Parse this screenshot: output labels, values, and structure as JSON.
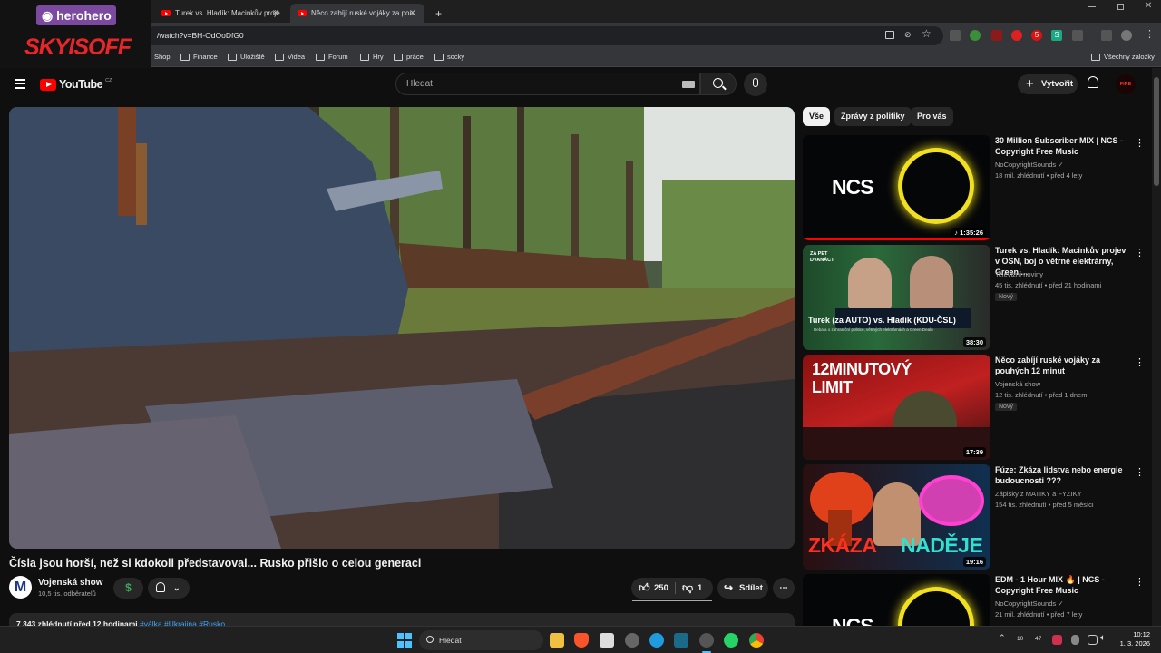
{
  "browser": {
    "tabs": [
      {
        "title": "Turek vs. Hladík: Macinkův proje",
        "close": "✕"
      },
      {
        "title": "Něco zabíjí ruské vojáky za pou",
        "close": "✕"
      }
    ],
    "new_tab": "+",
    "url": "/watch?v=BH-OdOoDfG0",
    "bookmarks": [
      "Shop",
      "Finance",
      "Uložiště",
      "Videa",
      "Forum",
      "Hry",
      "práce",
      "socky"
    ],
    "all_bookmarks": "Všechny záložky",
    "ext_badge": "5"
  },
  "overlay": {
    "brand_top": "herohero",
    "brand_main": "SKYISOFF"
  },
  "youtube": {
    "logo_text": "YouTube",
    "logo_country": "CZ",
    "search_placeholder": "Hledat",
    "create_label": "Vytvořit",
    "avatar_text": "FIRE OFF"
  },
  "video": {
    "title": "Čísla jsou horší, než si kdokoli představoval... Rusko přišlo o celou generaci",
    "channel": "Vojenská show",
    "channel_initial": "M",
    "subscribers": "10,5 tis. odběratelů",
    "likes": "250",
    "dislikes": "1",
    "share_label": "Sdílet",
    "description_meta": "7 343 zhlédnutí  před 12 hodinami",
    "description_tags": "#válka #Ukrajina #Rusko"
  },
  "chips": [
    "Vše",
    "Zprávy z politiky",
    "Pro vás"
  ],
  "recommendations": [
    {
      "title": "30 Million Subscriber MIX | NCS - Copyright Free Music",
      "channel": "NoCopyrightSounds",
      "meta": "18 mil. zhlédnutí • před 4 lety",
      "duration": "1:35:26",
      "badge": "",
      "thumb_text": "NCS",
      "thumb_sub": ""
    },
    {
      "title": "Turek vs. Hladík: Macinkův projev v OSN, boj o větrné elektrárny, Green ...",
      "channel": "Televizní noviny",
      "meta": "45 tis. zhlédnutí • před 21 hodinami",
      "duration": "38:30",
      "badge": "Nový",
      "thumb_text": "Turek (za AUTO) vs. Hladík (KDU-ČSL)",
      "thumb_sub": "Debata o zahraniční politice, větrných elektrárnách a Green Dealu"
    },
    {
      "title": "Něco zabíjí ruské vojáky za pouhých 12 minut",
      "channel": "Vojenská show",
      "meta": "12 tis. zhlédnutí • před 1 dnem",
      "duration": "17:39",
      "badge": "Nový",
      "thumb_text": "12MINUTOVÝ LIMIT",
      "thumb_sub": ""
    },
    {
      "title": "Fúze: Zkáza lidstva nebo energie budoucnosti ???",
      "channel": "Zápisky z MATIKY a FYZIKY",
      "meta": "154 tis. zhlédnutí • před 5 měsíci",
      "duration": "19:16",
      "badge": "",
      "thumb_text": "ZKÁZA",
      "thumb_sub": "NADĚJE"
    },
    {
      "title": "EDM - 1 Hour MIX 🔥 | NCS - Copyright Free Music",
      "channel": "NoCopyrightSounds",
      "meta": "21 mil. zhlédnutí • před 7 lety",
      "duration": "",
      "badge": "",
      "thumb_text": "NCS",
      "thumb_sub": ""
    }
  ],
  "taskbar": {
    "search": "Hledat",
    "tray_numbers": [
      "10",
      "47"
    ],
    "time": "10:12",
    "date": "1. 3. 2026"
  },
  "colors": {
    "accent_red": "#ff0000",
    "bg": "#0f0f0f",
    "chip": "#272727",
    "link": "#3ea6ff"
  }
}
